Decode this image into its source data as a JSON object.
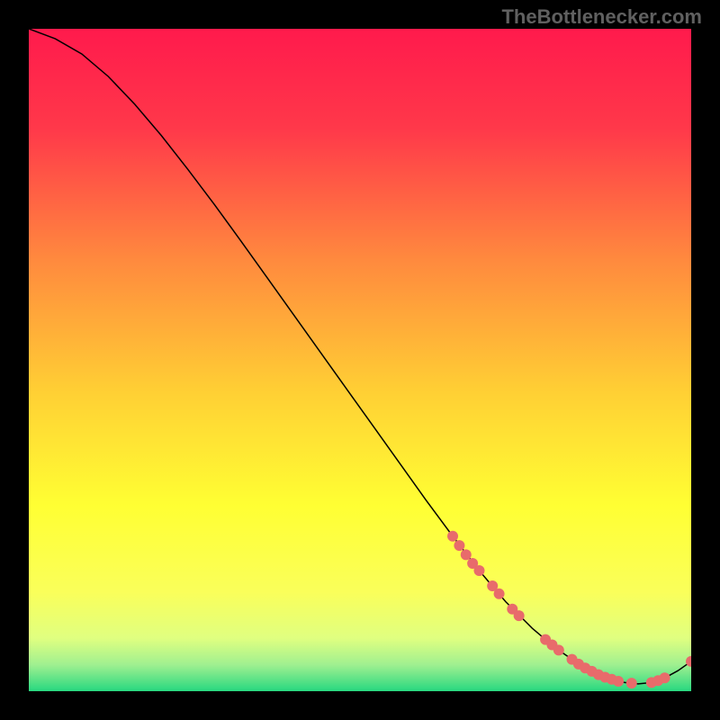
{
  "watermark": "TheBottlenecker.com",
  "chart_data": {
    "type": "line",
    "title": "",
    "xlabel": "",
    "ylabel": "",
    "xlim": [
      0,
      100
    ],
    "ylim": [
      0,
      100
    ],
    "background_gradient": {
      "stops": [
        {
          "offset": 0.0,
          "color": "#ff1a4c"
        },
        {
          "offset": 0.15,
          "color": "#ff384a"
        },
        {
          "offset": 0.35,
          "color": "#ff8a3e"
        },
        {
          "offset": 0.55,
          "color": "#ffd034"
        },
        {
          "offset": 0.72,
          "color": "#ffff33"
        },
        {
          "offset": 0.85,
          "color": "#faff5a"
        },
        {
          "offset": 0.92,
          "color": "#e0ff80"
        },
        {
          "offset": 0.96,
          "color": "#a0f090"
        },
        {
          "offset": 1.0,
          "color": "#28d880"
        }
      ]
    },
    "curve": {
      "x": [
        0,
        4,
        8,
        12,
        16,
        20,
        24,
        28,
        32,
        36,
        40,
        44,
        48,
        52,
        56,
        60,
        64,
        68,
        72,
        76,
        78,
        80,
        82,
        84,
        86,
        88,
        90,
        92,
        94,
        96,
        98,
        100
      ],
      "y": [
        100,
        98.5,
        96.2,
        92.8,
        88.6,
        83.9,
        78.8,
        73.5,
        68.0,
        62.4,
        56.8,
        51.2,
        45.6,
        40.0,
        34.4,
        28.8,
        23.4,
        18.2,
        13.5,
        9.5,
        7.8,
        6.2,
        4.8,
        3.5,
        2.5,
        1.8,
        1.3,
        1.1,
        1.3,
        2.0,
        3.1,
        4.5
      ]
    },
    "highlight_points": {
      "color": "#e86b6b",
      "points": [
        {
          "x": 64,
          "y": 23.4
        },
        {
          "x": 65,
          "y": 22.0
        },
        {
          "x": 66,
          "y": 20.6
        },
        {
          "x": 67,
          "y": 19.3
        },
        {
          "x": 68,
          "y": 18.2
        },
        {
          "x": 70,
          "y": 15.9
        },
        {
          "x": 71,
          "y": 14.7
        },
        {
          "x": 73,
          "y": 12.4
        },
        {
          "x": 74,
          "y": 11.4
        },
        {
          "x": 78,
          "y": 7.8
        },
        {
          "x": 79,
          "y": 7.0
        },
        {
          "x": 80,
          "y": 6.2
        },
        {
          "x": 82,
          "y": 4.8
        },
        {
          "x": 83,
          "y": 4.1
        },
        {
          "x": 84,
          "y": 3.5
        },
        {
          "x": 85,
          "y": 3.0
        },
        {
          "x": 86,
          "y": 2.5
        },
        {
          "x": 87,
          "y": 2.1
        },
        {
          "x": 88,
          "y": 1.8
        },
        {
          "x": 89,
          "y": 1.5
        },
        {
          "x": 91,
          "y": 1.2
        },
        {
          "x": 94,
          "y": 1.3
        },
        {
          "x": 95,
          "y": 1.6
        },
        {
          "x": 96,
          "y": 2.0
        },
        {
          "x": 100,
          "y": 4.5
        }
      ]
    }
  }
}
